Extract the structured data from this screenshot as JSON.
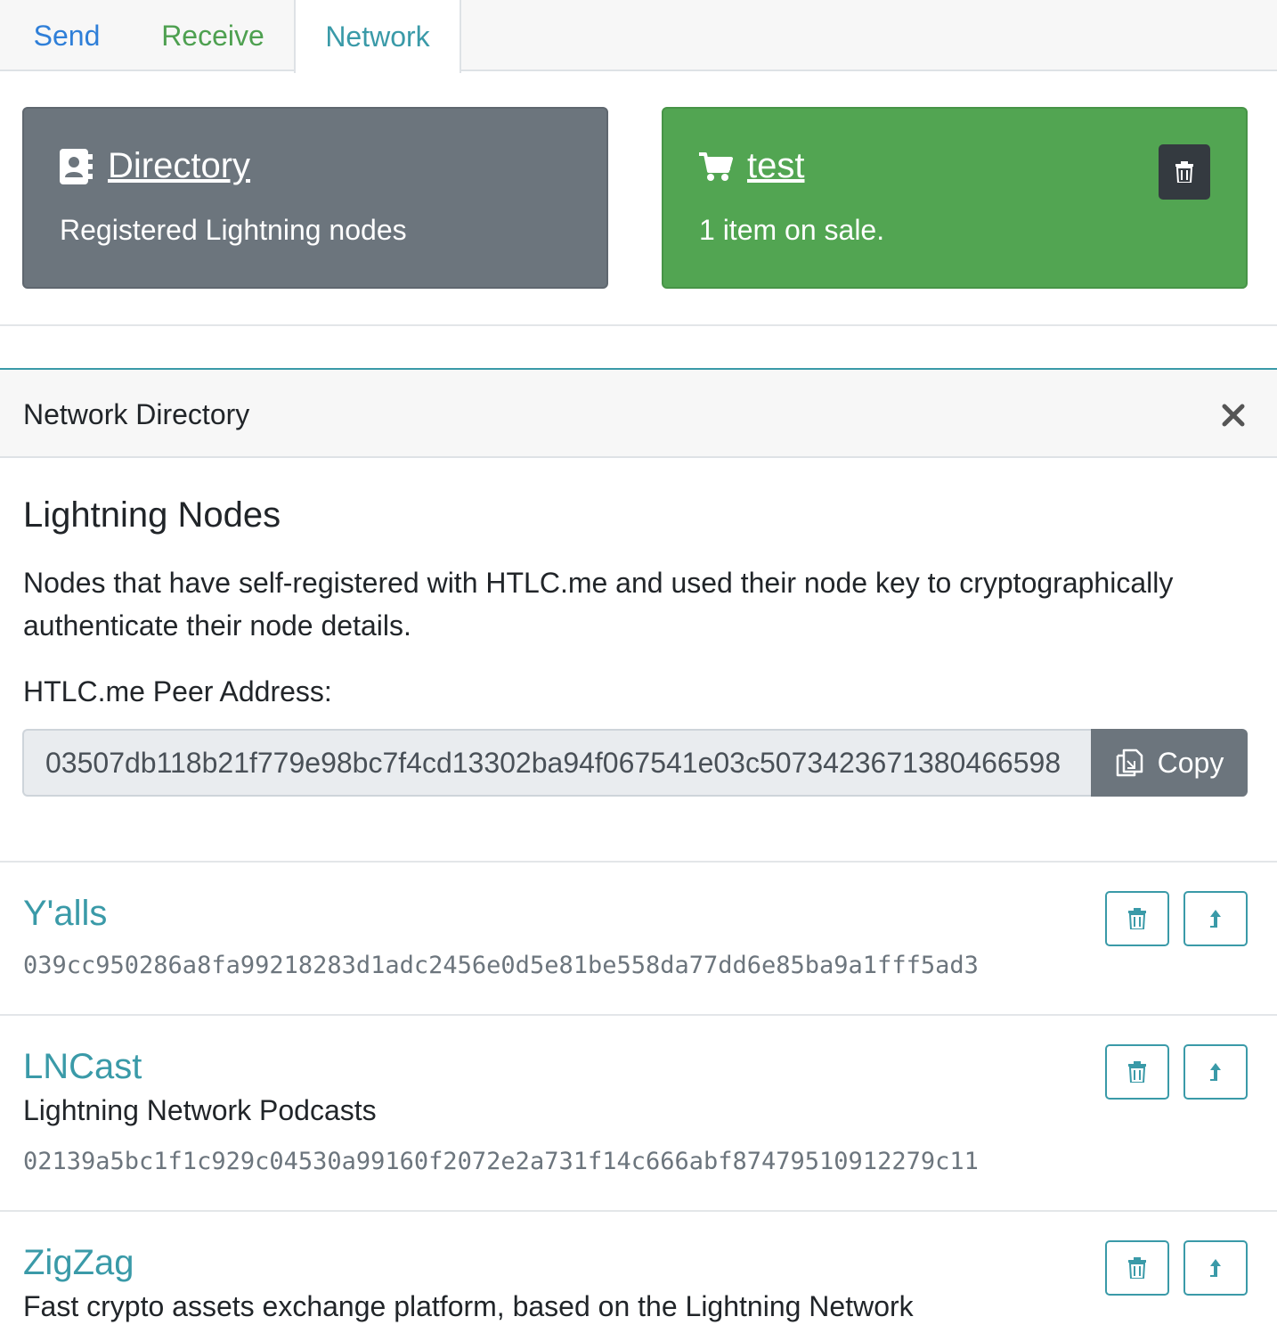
{
  "tabs": {
    "send": "Send",
    "receive": "Receive",
    "network": "Network"
  },
  "cards": {
    "directory": {
      "title": "Directory",
      "subtitle": "Registered Lightning nodes",
      "icon": "address-book-icon"
    },
    "shop": {
      "title": "test",
      "subtitle": "1 item on sale.",
      "icon": "shopping-cart-icon"
    }
  },
  "panel": {
    "title": "Network Directory",
    "heading": "Lightning Nodes",
    "description": "Nodes that have self-registered with HTLC.me and used their node key to cryptographically authenticate their node details.",
    "peer_label": "HTLC.me Peer Address:",
    "peer_address": "03507db118b21f779e98bc7f4cd13302ba94f067541e03c5073423671380466598",
    "copy_label": "Copy"
  },
  "nodes": [
    {
      "name": "Y'alls",
      "description": "",
      "key": "039cc950286a8fa99218283d1adc2456e0d5e81be558da77dd6e85ba9a1fff5ad3"
    },
    {
      "name": "LNCast",
      "description": "Lightning Network Podcasts",
      "key": "02139a5bc1f1c929c04530a99160f2072e2a731f14c666abf87479510912279c11"
    },
    {
      "name": "ZigZag",
      "description": "Fast crypto assets exchange platform, based on the Lightning Network",
      "key": ""
    }
  ],
  "colors": {
    "accent": "#3a9aa8",
    "secondary": "#6c757d",
    "success": "#52a552",
    "dark": "#343a40"
  }
}
